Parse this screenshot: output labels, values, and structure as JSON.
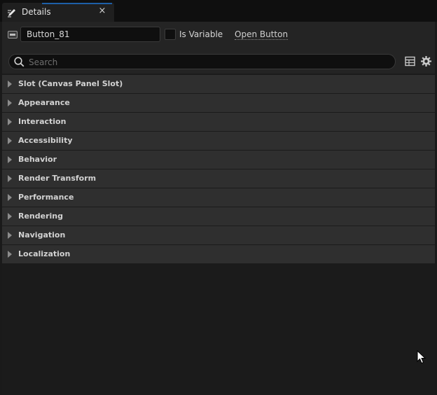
{
  "tab": {
    "title": "Details",
    "close_glyph": "×"
  },
  "header": {
    "widget_name": "Button_81",
    "is_variable_label": "Is Variable",
    "is_variable_checked": false,
    "open_link": "Open Button"
  },
  "search": {
    "placeholder": "Search",
    "value": ""
  },
  "categories": [
    {
      "label": "Slot (Canvas Panel Slot)"
    },
    {
      "label": "Appearance"
    },
    {
      "label": "Interaction"
    },
    {
      "label": "Accessibility"
    },
    {
      "label": "Behavior"
    },
    {
      "label": "Render Transform"
    },
    {
      "label": "Performance"
    },
    {
      "label": "Rendering"
    },
    {
      "label": "Navigation"
    },
    {
      "label": "Localization"
    }
  ],
  "icons": {
    "tab": "pencil-edit-icon",
    "widget": "widget-icon",
    "search": "search-icon",
    "view_options": "table-view-icon",
    "settings": "gear-icon"
  },
  "colors": {
    "background": "#1a1a1a",
    "panel": "#242424",
    "category_row": "#2f2f2f",
    "tab_accent": "#1e5fa8",
    "text": "#d2d2d2"
  }
}
